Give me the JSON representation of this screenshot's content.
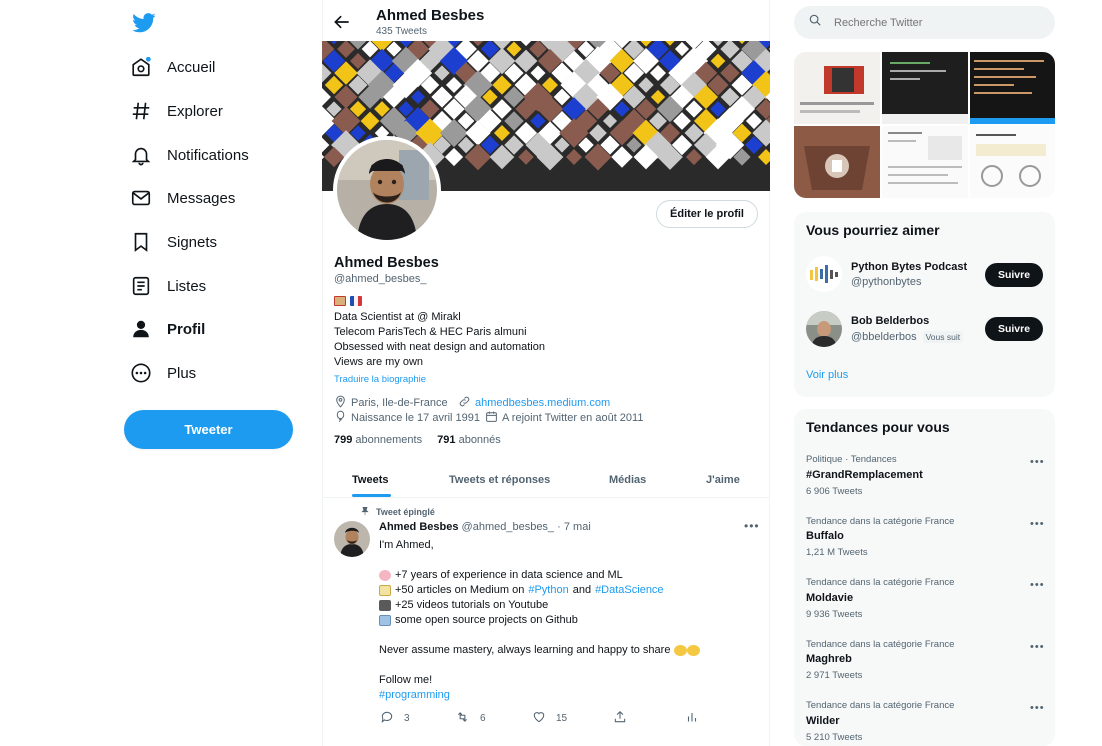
{
  "colors": {
    "accent": "#1d9bf0",
    "text": "#0f1419",
    "muted": "#536471",
    "panel": "#f7f9f9"
  },
  "nav": {
    "logo_icon": "twitter-bird-icon",
    "items": [
      {
        "label": "Accueil",
        "icon": "home-icon"
      },
      {
        "label": "Explorer",
        "icon": "hashtag-icon"
      },
      {
        "label": "Notifications",
        "icon": "bell-icon"
      },
      {
        "label": "Messages",
        "icon": "envelope-icon"
      },
      {
        "label": "Signets",
        "icon": "bookmark-icon"
      },
      {
        "label": "Listes",
        "icon": "list-icon"
      },
      {
        "label": "Profil",
        "icon": "person-icon",
        "active": true
      },
      {
        "label": "Plus",
        "icon": "more-circle-icon"
      }
    ],
    "tweet_button": "Tweeter"
  },
  "header": {
    "name": "Ahmed Besbes",
    "tweet_count": "435 Tweets"
  },
  "profile": {
    "edit_button": "Éditer le profil",
    "name": "Ahmed Besbes",
    "handle": "@ahmed_besbes_",
    "bio": [
      "Data Scientist at @ Mirakl",
      "Telecom ParisTech & HEC Paris almuni",
      "Obsessed with neat design and automation",
      "Views are my own"
    ],
    "translate": "Traduire la biographie",
    "location": "Paris, Ile-de-France",
    "website": "ahmedbesbes.medium.com",
    "birth": "Naissance le 17 avril 1991",
    "joined": "A rejoint Twitter en août 2011",
    "following_count": "799",
    "following_label": "abonnements",
    "followers_count": "791",
    "followers_label": "abonnés"
  },
  "tabs": [
    "Tweets",
    "Tweets et réponses",
    "Médias",
    "J'aime"
  ],
  "tweet": {
    "pinned_label": "Tweet épinglé",
    "author": "Ahmed Besbes",
    "handle": "@ahmed_besbes_",
    "separator": "·",
    "date": "7 mai",
    "greeting": "I'm Ahmed,",
    "line1": "+7 years of experience in data science and ML",
    "line2_a": "+50 articles on Medium on",
    "line2_tag1": "#Python",
    "line2_and": "and",
    "line2_tag2": "#DataScience",
    "line3": "+25 videos tutorials on Youtube",
    "line4": "some open source projects on Github",
    "line5": "Never assume mastery, always learning and happy to share",
    "line6": "Follow me!",
    "hashtag": "#programming",
    "replies": "3",
    "retweets": "6",
    "likes": "15"
  },
  "search": {
    "placeholder": "Recherche Twitter"
  },
  "suggestions": {
    "title": "Vous pourriez aimer",
    "items": [
      {
        "name": "Python Bytes Podcast",
        "handle": "@pythonbytes",
        "button": "Suivre"
      },
      {
        "name": "Bob Belderbos",
        "handle": "@bbelderbos",
        "badge": "Vous suit",
        "button": "Suivre"
      }
    ],
    "more": "Voir plus"
  },
  "trends": {
    "title": "Tendances pour vous",
    "items": [
      {
        "category": "Politique · Tendances",
        "name": "#GrandRemplacement",
        "count": "6 906 Tweets"
      },
      {
        "category": "Tendance dans la catégorie France",
        "name": "Buffalo",
        "count": "1,21 M Tweets"
      },
      {
        "category": "Tendance dans la catégorie France",
        "name": "Moldavie",
        "count": "9 936 Tweets"
      },
      {
        "category": "Tendance dans la catégorie France",
        "name": "Maghreb",
        "count": "2 971 Tweets"
      },
      {
        "category": "Tendance dans la catégorie France",
        "name": "Wilder",
        "count": "5 210 Tweets"
      }
    ]
  }
}
